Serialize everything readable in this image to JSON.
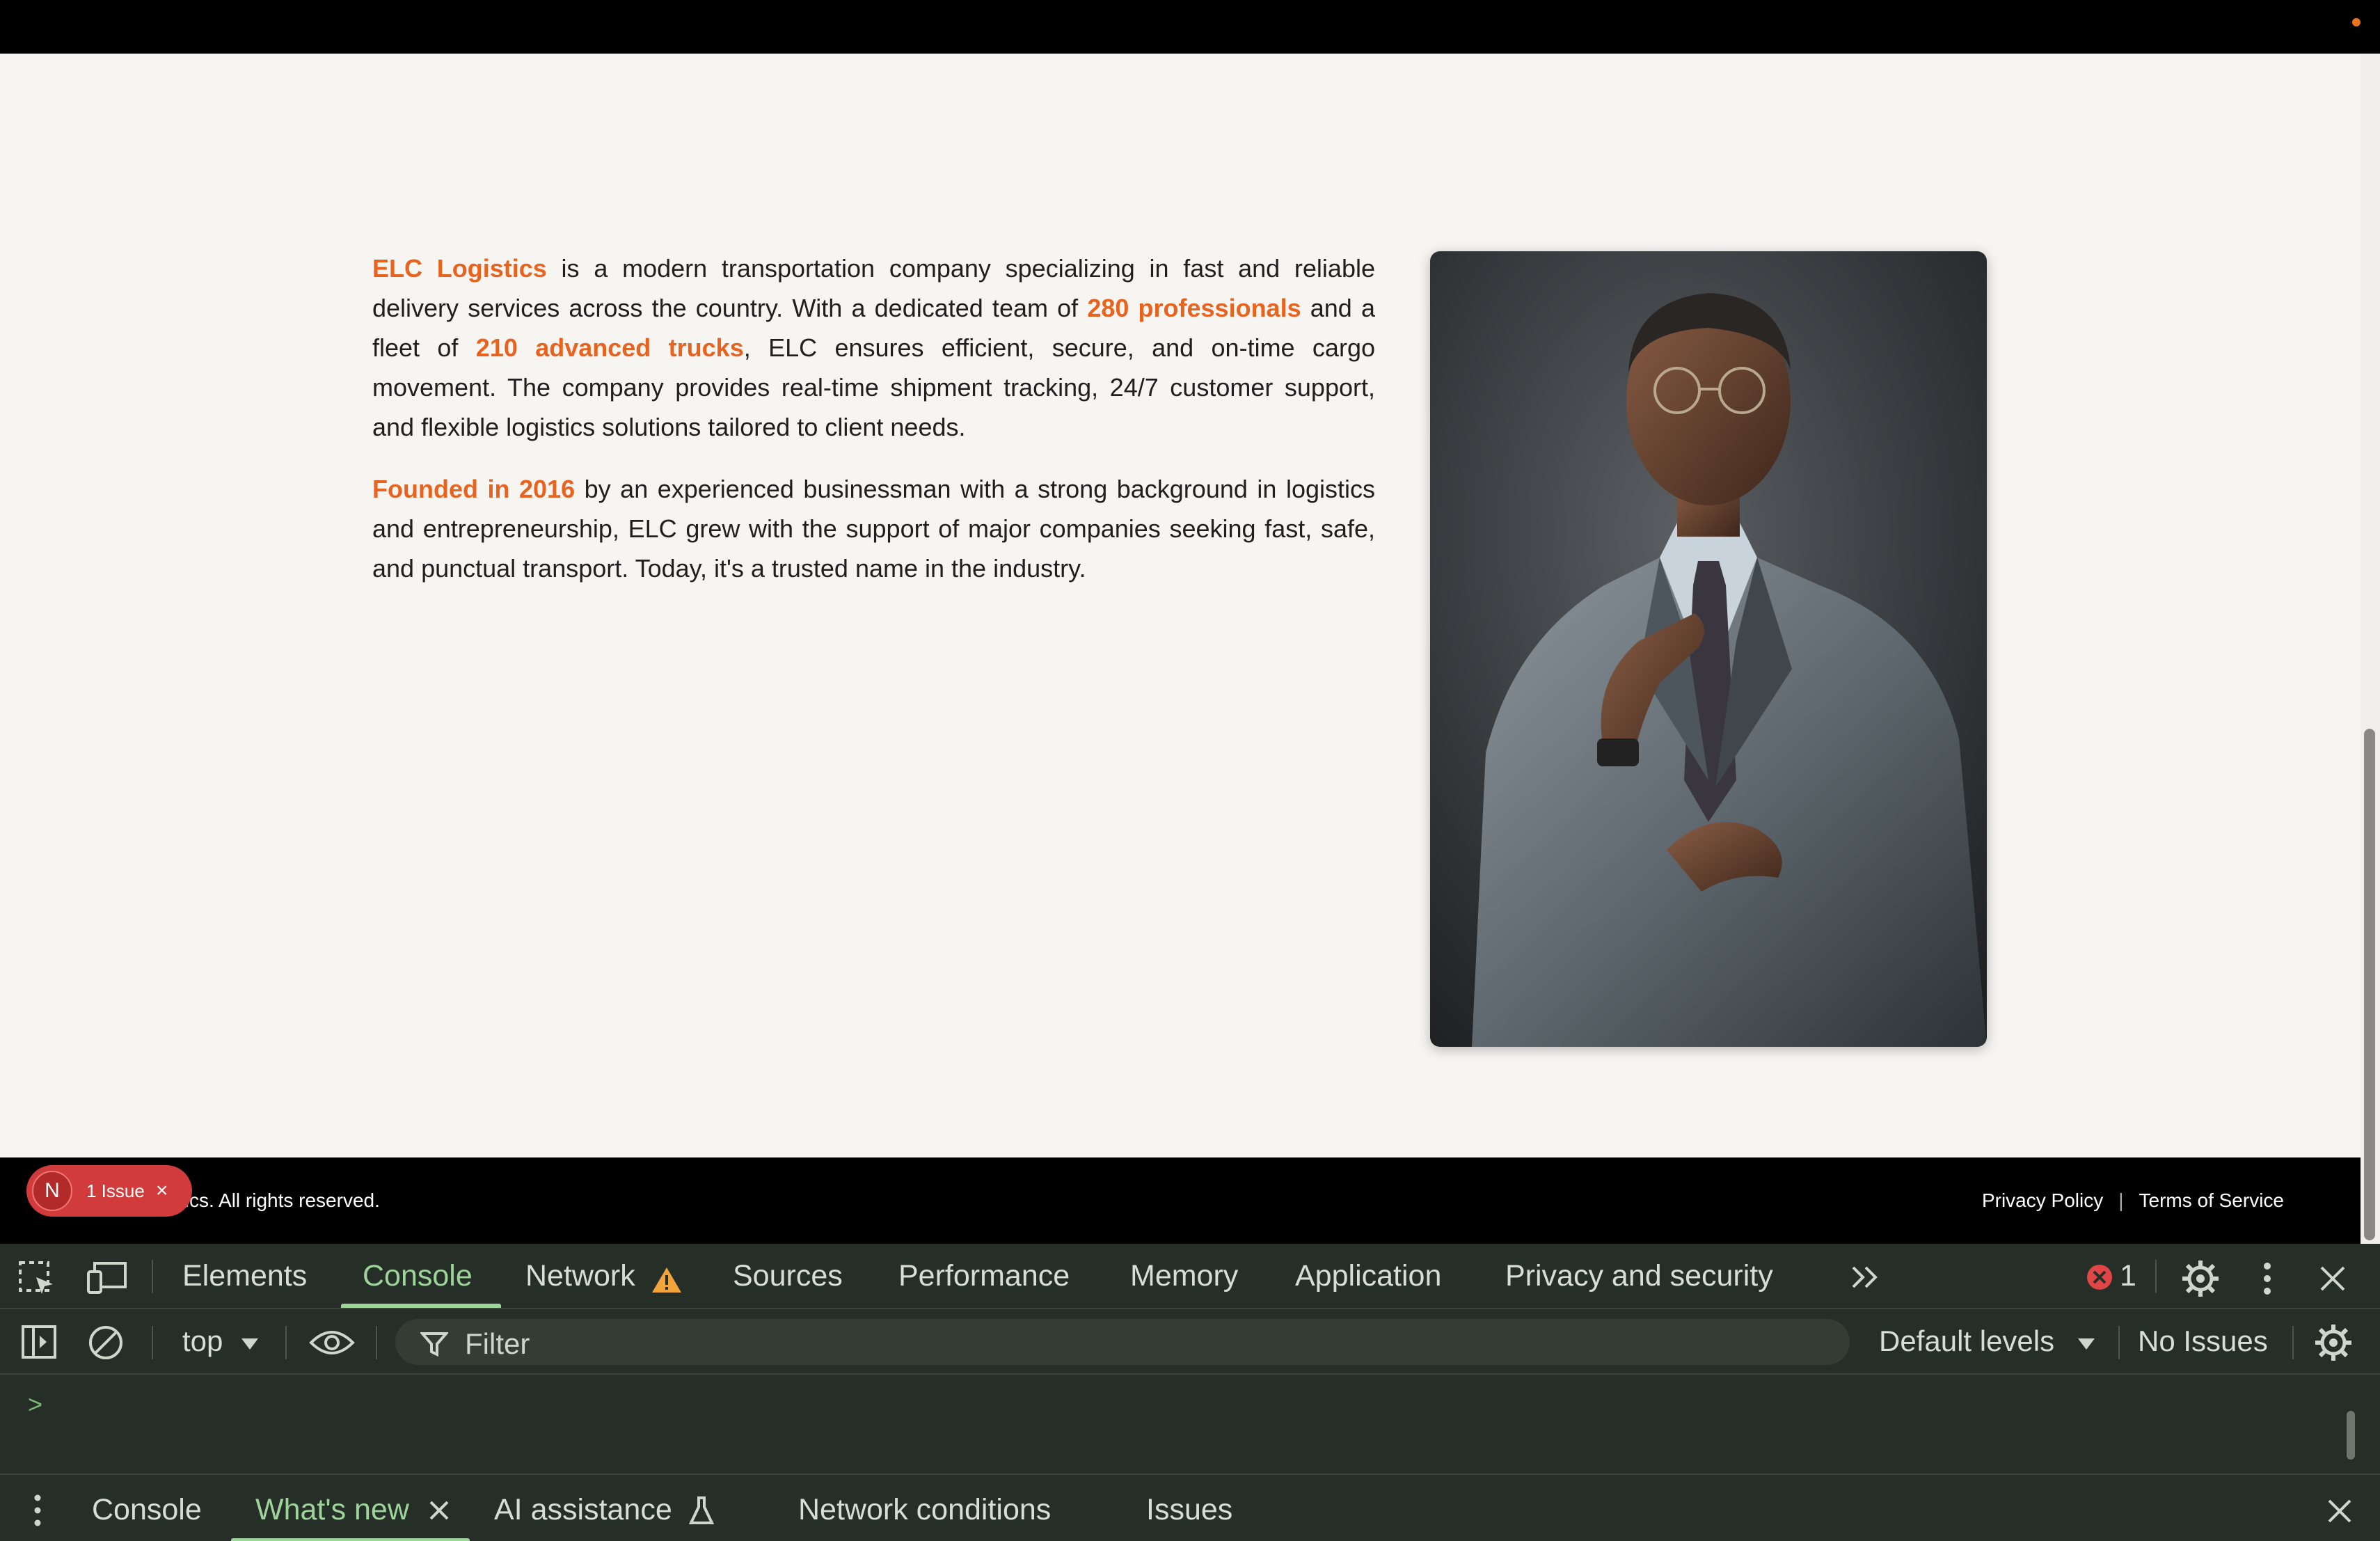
{
  "about": {
    "p1": {
      "brand": "ELC Logistics",
      "t1": " is a modern transportation company specializing in fast and reliable delivery services across the country. With a dedicated team of ",
      "staff": "280 professionals",
      "t2": " and a fleet of ",
      "trucks": "210 advanced trucks",
      "t3": ", ELC ensures efficient, secure, and on-time cargo movement. The company provides real-time shipment tracking, 24/7 customer support, and flexible logistics solutions tailored to client needs."
    },
    "p2": {
      "founded": "Founded in 2016",
      "t1": " by an experienced businessman with a strong background in logistics and entrepreneurship, ELC grew with the support of major companies seeking fast, safe, and punctual transport. Today, it's a trusted name in the industry."
    }
  },
  "footer": {
    "copyright": "tics. All rights reserved.",
    "privacy": "Privacy Policy",
    "separator": "|",
    "terms": "Terms of Service"
  },
  "issue_pill": {
    "avatar": "N",
    "label": "1 Issue",
    "close": "×"
  },
  "devtools": {
    "tabs": [
      "Elements",
      "Console",
      "Network",
      "Sources",
      "Performance",
      "Memory",
      "Application",
      "Privacy and security"
    ],
    "active_tab": "Console",
    "error_count": "1",
    "context": "top",
    "filter_placeholder": "Filter",
    "levels": "Default levels",
    "issues": "No Issues",
    "prompt": ">",
    "drawer_tabs": [
      "Console",
      "What's new",
      "AI assistance",
      "Network conditions",
      "Issues"
    ],
    "drawer_active": "What's new"
  },
  "colors": {
    "accent": "#e8641e",
    "devtools_bg": "#262f27",
    "devtools_active": "#9ed39a",
    "error": "#e04646"
  }
}
